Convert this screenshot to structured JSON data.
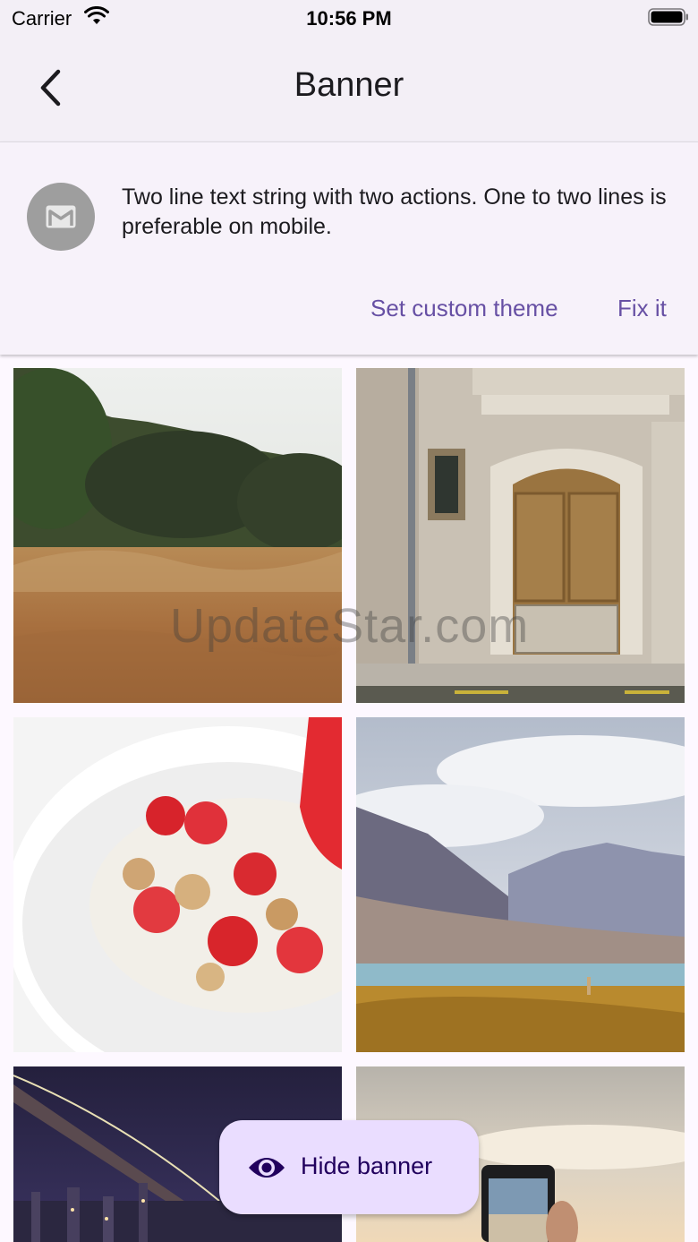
{
  "status_bar": {
    "carrier": "Carrier",
    "time": "10:56 PM",
    "icons": [
      "wifi-icon",
      "battery-icon"
    ]
  },
  "app_bar": {
    "title": "Banner",
    "back_icon": "chevron-left-icon"
  },
  "banner": {
    "avatar_icon": "mail-icon",
    "text": "Two line text string with two actions. One to two lines is preferable on mobile.",
    "actions": [
      "Set custom theme",
      "Fix it"
    ]
  },
  "gallery": {
    "images": [
      "dry-grass-field",
      "old-wooden-door",
      "yogurt-granola-strawberries",
      "mountain-lake-llama",
      "bridge-city-night",
      "phone-photo-sunset"
    ]
  },
  "watermark": "UpdateStar.com",
  "fab": {
    "label": "Hide banner",
    "icon": "eye-icon"
  },
  "colors": {
    "accent": "#6750a4",
    "fab_background": "#eaddff",
    "fab_text": "#21005d",
    "app_bar_background": "#f3eff6"
  }
}
